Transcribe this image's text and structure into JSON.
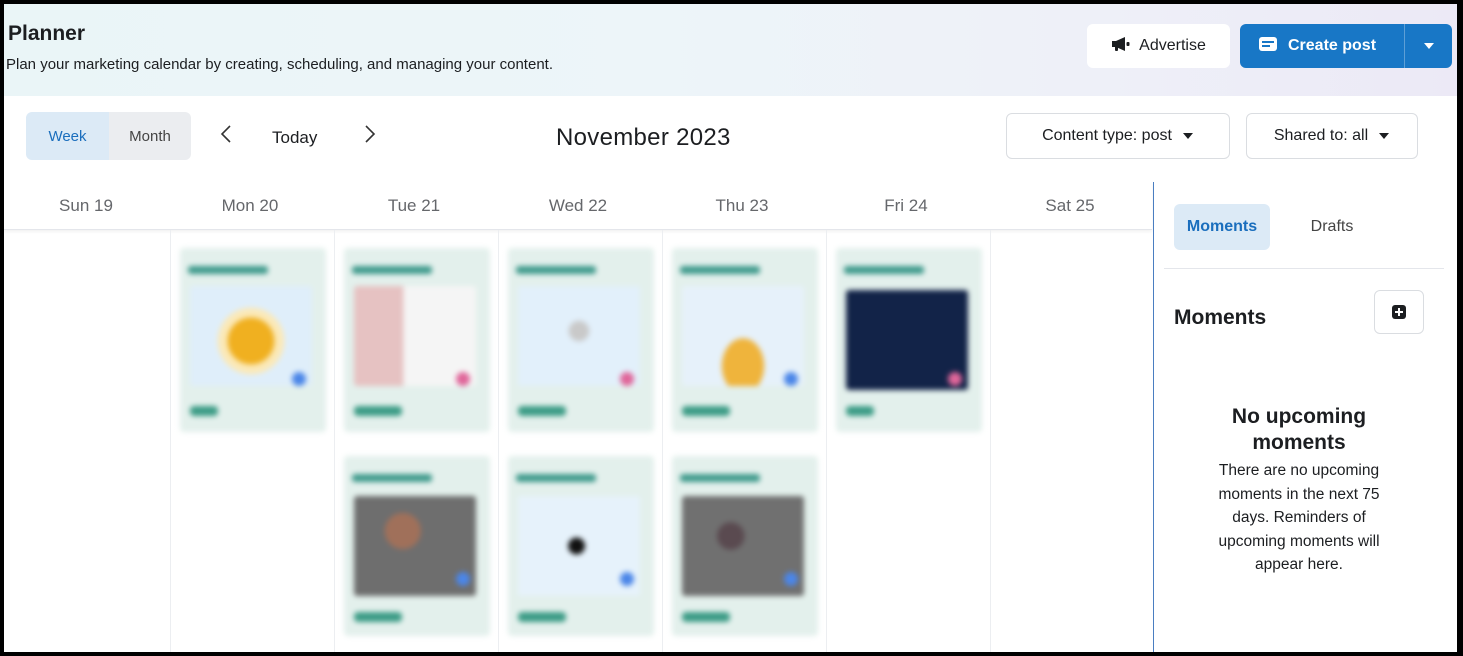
{
  "header": {
    "title": "Planner",
    "subtitle": "Plan your marketing calendar by creating, scheduling, and managing your content.",
    "advertise_label": "Advertise",
    "create_post_label": "Create post"
  },
  "toolbar": {
    "view_week": "Week",
    "view_month": "Month",
    "active_view": "Week",
    "prev": "‹",
    "today": "Today",
    "next": "›",
    "month_label": "November 2023",
    "content_type_filter": "Content type: post",
    "shared_to_filter": "Shared to: all"
  },
  "calendar": {
    "days": [
      "Sun 19",
      "Mon 20",
      "Tue 21",
      "Wed 22",
      "Thu 23",
      "Fri 24",
      "Sat 25"
    ],
    "posts_per_day": [
      0,
      1,
      2,
      2,
      2,
      1,
      0
    ]
  },
  "sidebar": {
    "tab_moments": "Moments",
    "tab_drafts": "Drafts",
    "active_tab": "Moments",
    "moments_heading": "Moments",
    "empty_title": "No upcoming moments",
    "empty_body": "There are no upcoming moments in the next 75 days. Reminders of upcoming moments will appear here."
  },
  "colors": {
    "primary": "#1877c6",
    "active_tab_bg": "#dceaf6",
    "card_bg": "#e3f0ec"
  }
}
